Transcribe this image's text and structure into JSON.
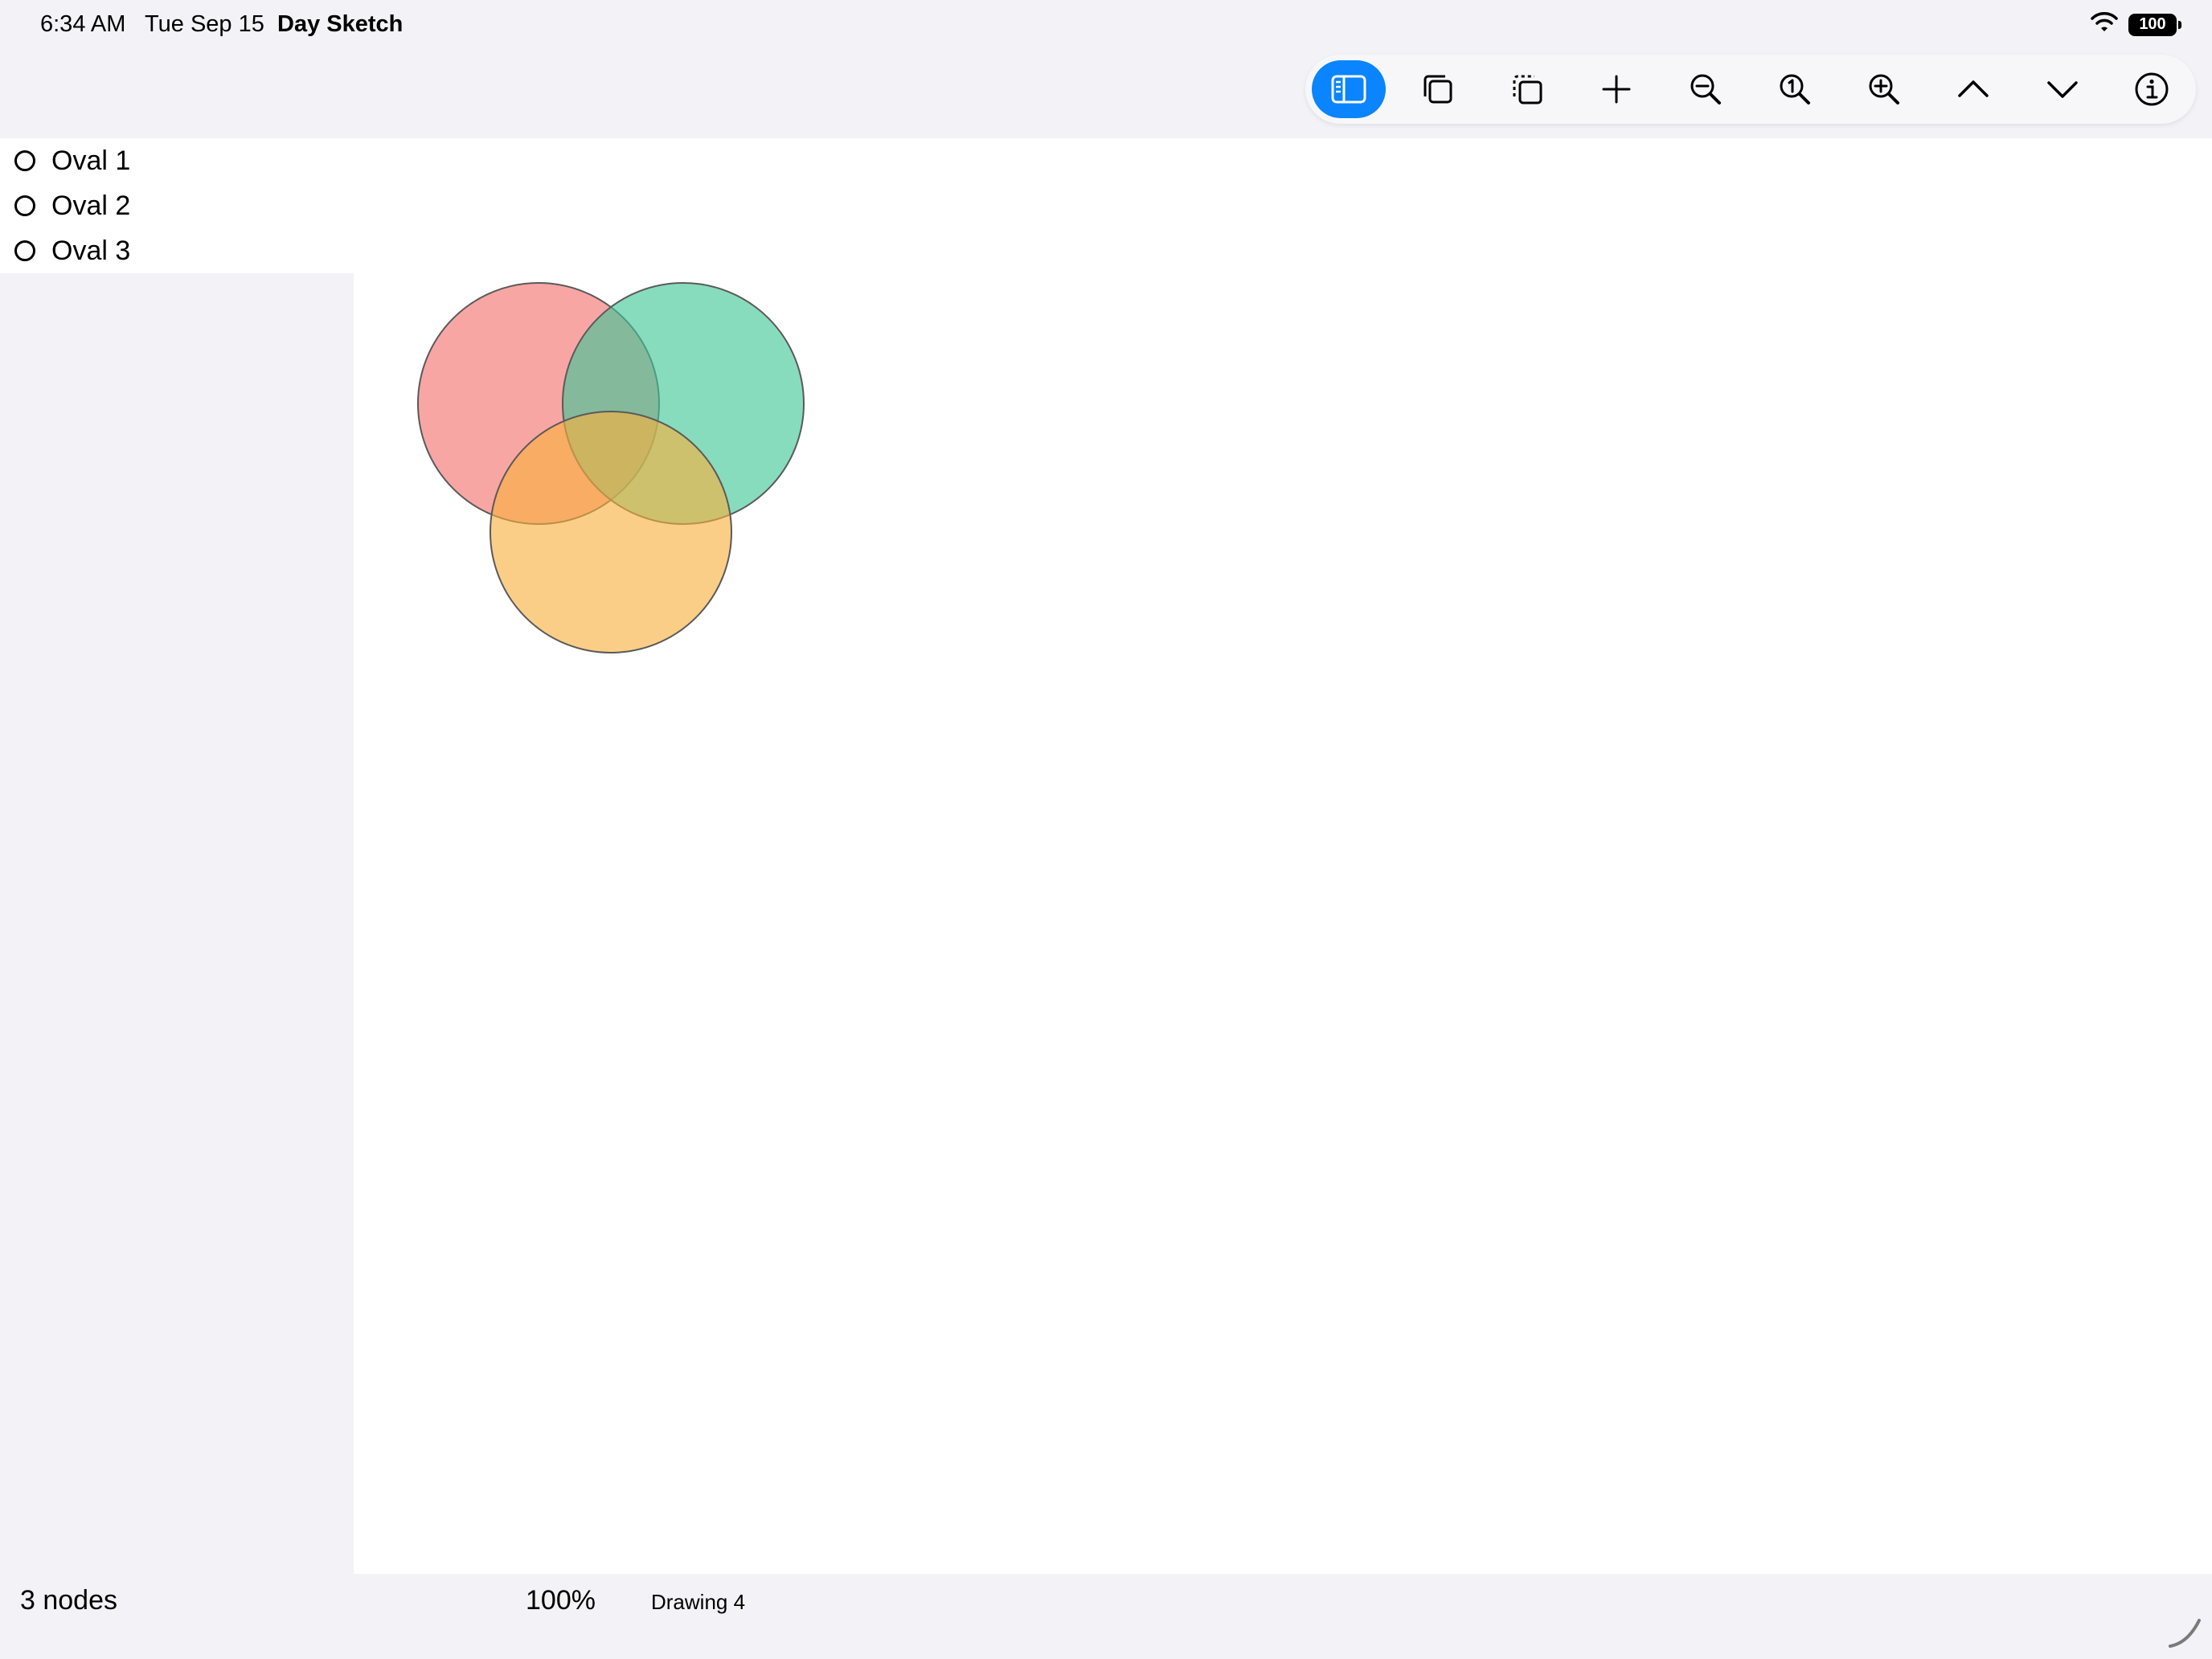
{
  "status_bar": {
    "time": "6:34 AM",
    "date": "Tue Sep 15",
    "app_name": "Day Sketch",
    "battery": "100"
  },
  "toolbar": {
    "buttons": [
      {
        "icon": "sidebar-icon",
        "active": true
      },
      {
        "icon": "duplicate-icon"
      },
      {
        "icon": "copy-selection-icon"
      },
      {
        "icon": "plus-icon"
      },
      {
        "icon": "zoom-out-icon"
      },
      {
        "icon": "zoom-actual-icon"
      },
      {
        "icon": "zoom-in-icon"
      },
      {
        "icon": "chevron-up-icon"
      },
      {
        "icon": "chevron-down-icon"
      },
      {
        "icon": "info-icon"
      }
    ]
  },
  "sidebar": {
    "items": [
      {
        "label": "Oval 1"
      },
      {
        "label": "Oval 2"
      },
      {
        "label": "Oval 3"
      }
    ]
  },
  "canvas": {
    "shapes": [
      {
        "name": "Oval 1",
        "fill": "#f4706c",
        "opacity": 0.62
      },
      {
        "name": "Oval 2",
        "fill": "#3ec796",
        "opacity": 0.62
      },
      {
        "name": "Oval 3",
        "fill": "#f8b03d",
        "opacity": 0.62
      }
    ],
    "stroke_color": "#5a5a5a"
  },
  "footer": {
    "node_count": "3 nodes",
    "zoom": "100%",
    "document_title": "Drawing 4"
  },
  "colors": {
    "accent": "#0a84ff",
    "background": "#f2f2f7"
  }
}
